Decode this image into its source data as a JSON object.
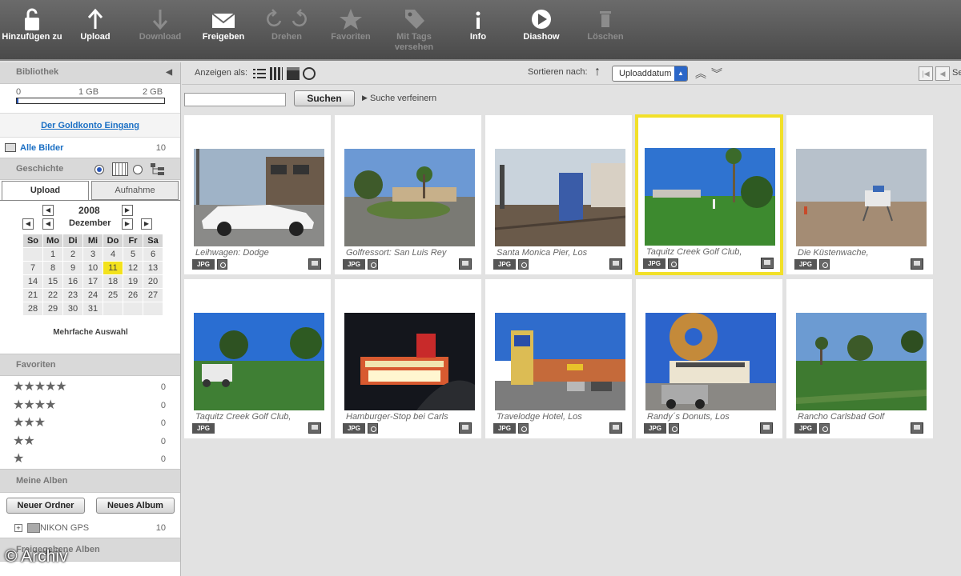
{
  "toolbar": {
    "add": "Hinzufügen zu",
    "upload": "Upload",
    "download": "Download",
    "share": "Freigeben",
    "rotate": "Drehen",
    "favorites": "Favoriten",
    "tag1": "Mit Tags",
    "tag2": "versehen",
    "info": "Info",
    "slideshow": "Diashow",
    "delete": "Löschen"
  },
  "sidebar": {
    "library": "Bibliothek",
    "storage": {
      "min": "0",
      "mid": "1 GB",
      "max": "2 GB",
      "used_fraction": 0.01
    },
    "goldkonto": "Der Goldkonto Eingang",
    "all_pictures": "Alle Bilder",
    "all_count": "10",
    "history": "Geschichte",
    "tabs": [
      "Upload",
      "Aufnahme"
    ],
    "calendar": {
      "year": "2008",
      "month": "Dezember",
      "weekdays": [
        "So",
        "Mo",
        "Di",
        "Mi",
        "Do",
        "Fr",
        "Sa"
      ],
      "weeks": [
        [
          "",
          "1",
          "2",
          "3",
          "4",
          "5",
          "6"
        ],
        [
          "7",
          "8",
          "9",
          "10",
          "11",
          "12",
          "13"
        ],
        [
          "14",
          "15",
          "16",
          "17",
          "18",
          "19",
          "20"
        ],
        [
          "21",
          "22",
          "23",
          "24",
          "25",
          "26",
          "27"
        ],
        [
          "28",
          "29",
          "30",
          "31",
          "",
          "",
          ""
        ]
      ],
      "highlight": "11",
      "multi": "Mehrfache Auswahl"
    },
    "favorites_title": "Favoriten",
    "ratings": [
      {
        "stars": "★★★★★",
        "count": "0"
      },
      {
        "stars": "★★★★",
        "count": "0"
      },
      {
        "stars": "★★★",
        "count": "0"
      },
      {
        "stars": "★★",
        "count": "0"
      },
      {
        "stars": "★",
        "count": "0"
      }
    ],
    "albums_title": "Meine Alben",
    "new_folder": "Neuer Ordner",
    "new_album": "Neues Album",
    "folder": {
      "name": "NIKON GPS",
      "count": "10"
    },
    "shared": "Freigegebene Alben",
    "watermark": "© Archiv"
  },
  "topbar": {
    "show_as": "Anzeigen als:",
    "sort_by": "Sortieren nach:",
    "sort_value": "Uploaddatum",
    "trailing": "Se"
  },
  "search": {
    "placeholder": "",
    "button": "Suchen",
    "refine": "Suche verfeinern"
  },
  "photos": [
    {
      "caption": "Leihwagen: Dodge",
      "gps": true,
      "kind": "car"
    },
    {
      "caption": "Golfressort: San Luis Rey",
      "gps": true,
      "kind": "resort"
    },
    {
      "caption": "Santa Monica Pier, Los",
      "gps": true,
      "kind": "pier"
    },
    {
      "caption": "Taquitz Creek Golf Club,",
      "gps": true,
      "kind": "golf",
      "selected": true
    },
    {
      "caption": "Die Küstenwache,",
      "gps": true,
      "kind": "beach"
    },
    {
      "caption": "Taquitz Creek Golf Club,",
      "gps": false,
      "kind": "golf2"
    },
    {
      "caption": "Hamburger-Stop bei Carls",
      "gps": true,
      "kind": "night"
    },
    {
      "caption": "Travelodge Hotel, Los",
      "gps": true,
      "kind": "hotel"
    },
    {
      "caption": "Randy´s Donuts, Los",
      "gps": true,
      "kind": "donut"
    },
    {
      "caption": "Rancho Carlsbad Golf",
      "gps": true,
      "kind": "rancho"
    }
  ]
}
